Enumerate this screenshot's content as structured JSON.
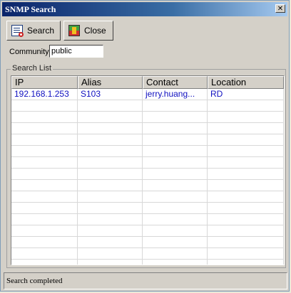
{
  "window": {
    "title": "SNMP Search"
  },
  "toolbar": {
    "search_label": "Search",
    "close_label": "Close"
  },
  "community": {
    "label": "Community",
    "value": "public"
  },
  "search_list": {
    "label": "Search List",
    "columns": [
      "IP",
      "Alias",
      "Contact",
      "Location"
    ],
    "rows": [
      {
        "ip": "192.168.1.253",
        "alias": "S103",
        "contact": "jerry.huang...",
        "location": "RD"
      }
    ]
  },
  "status": {
    "text": "Search completed"
  },
  "colors": {
    "title_gradient_start": "#0a246a",
    "row_text": "#1010c0",
    "window_bg": "#d4d0c8"
  }
}
